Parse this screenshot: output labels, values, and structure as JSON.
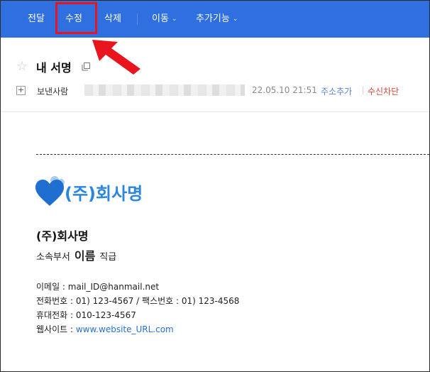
{
  "toolbar": {
    "forward": "전달",
    "edit": "수정",
    "delete": "삭제",
    "move": "이동",
    "more": "추가기능"
  },
  "header": {
    "subject": "내 서명",
    "sender_label": "보낸사람",
    "date": "22.05.10 21:51",
    "add_address": "주소추가",
    "block_receive": "수신차단"
  },
  "signature": {
    "logo_text": "(주)회사명",
    "company": "(주)회사명",
    "department": "소속부서",
    "name": "이름",
    "title": "직급",
    "email_label": "이메일 : ",
    "email": "mail_ID@hanmail.net",
    "phone_line": "전화번호 : 01) 123-4567 / 팩스번호 : 01) 123-4568",
    "mobile_line": "휴대전화 : 010-123-4567",
    "website_label": "웹사이트 : ",
    "website": "www.website_URL.com"
  },
  "colors": {
    "toolbar_bg": "#2f6fe0",
    "highlight": "#e8141e",
    "logo_blue": "#2a86df",
    "link_blue": "#2a6fd1",
    "block_red": "#e0453a"
  },
  "icons": [
    "chevron-down-icon",
    "star-icon",
    "copy-icon",
    "plus-icon",
    "heart-logo-icon",
    "arrow-pointer-icon"
  ]
}
